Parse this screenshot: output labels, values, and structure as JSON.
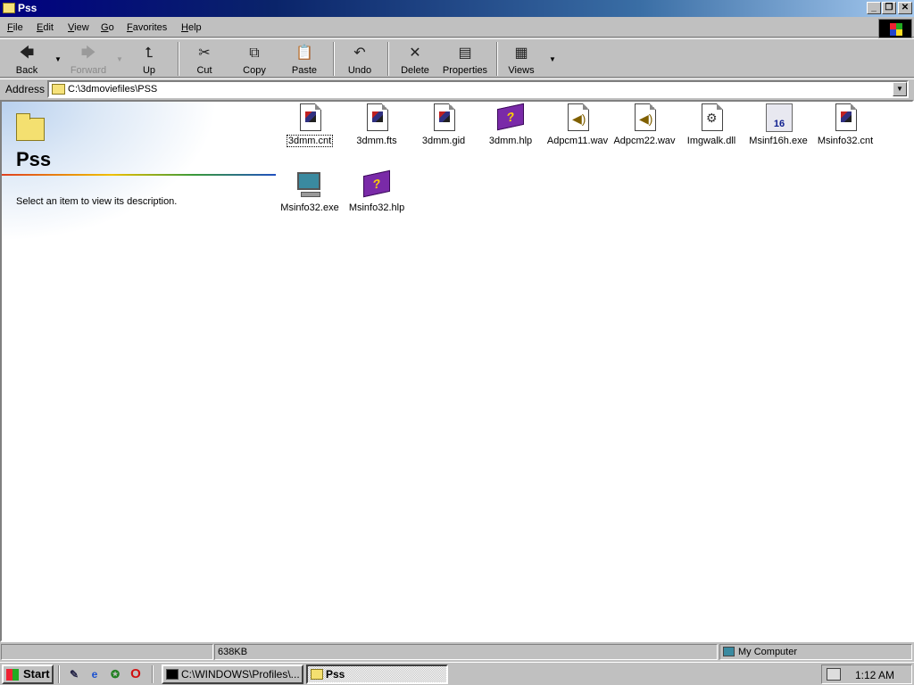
{
  "window": {
    "title": "Pss"
  },
  "menu": [
    "File",
    "Edit",
    "View",
    "Go",
    "Favorites",
    "Help"
  ],
  "toolbar": {
    "back": "Back",
    "forward": "Forward",
    "up": "Up",
    "cut": "Cut",
    "copy": "Copy",
    "paste": "Paste",
    "undo": "Undo",
    "delete": "Delete",
    "properties": "Properties",
    "views": "Views"
  },
  "address": {
    "label": "Address",
    "value": "C:\\3dmoviefiles\\PSS"
  },
  "left_panel": {
    "title": "Pss",
    "description": "Select an item to view its description."
  },
  "files": [
    {
      "name": "3dmm.cnt",
      "icon": "help-contents-icon"
    },
    {
      "name": "3dmm.fts",
      "icon": "help-contents-icon"
    },
    {
      "name": "3dmm.gid",
      "icon": "help-contents-icon"
    },
    {
      "name": "3dmm.hlp",
      "icon": "help-book-icon"
    },
    {
      "name": "Adpcm11.wav",
      "icon": "sound-file-icon"
    },
    {
      "name": "Adpcm22.wav",
      "icon": "sound-file-icon"
    },
    {
      "name": "Imgwalk.dll",
      "icon": "dll-gear-icon"
    },
    {
      "name": "Msinf16h.exe",
      "icon": "msinfo16-icon"
    },
    {
      "name": "Msinfo32.cnt",
      "icon": "help-contents-icon"
    },
    {
      "name": "Msinfo32.exe",
      "icon": "msinfo-computer-icon"
    },
    {
      "name": "Msinfo32.hlp",
      "icon": "help-book-icon"
    }
  ],
  "status": {
    "size": "638KB",
    "location": "My Computer"
  },
  "taskbar": {
    "start": "Start",
    "tasks": [
      {
        "label": "C:\\WINDOWS\\Profiles\\...",
        "active": false
      },
      {
        "label": "Pss",
        "active": true
      }
    ],
    "clock": "1:12 AM"
  }
}
